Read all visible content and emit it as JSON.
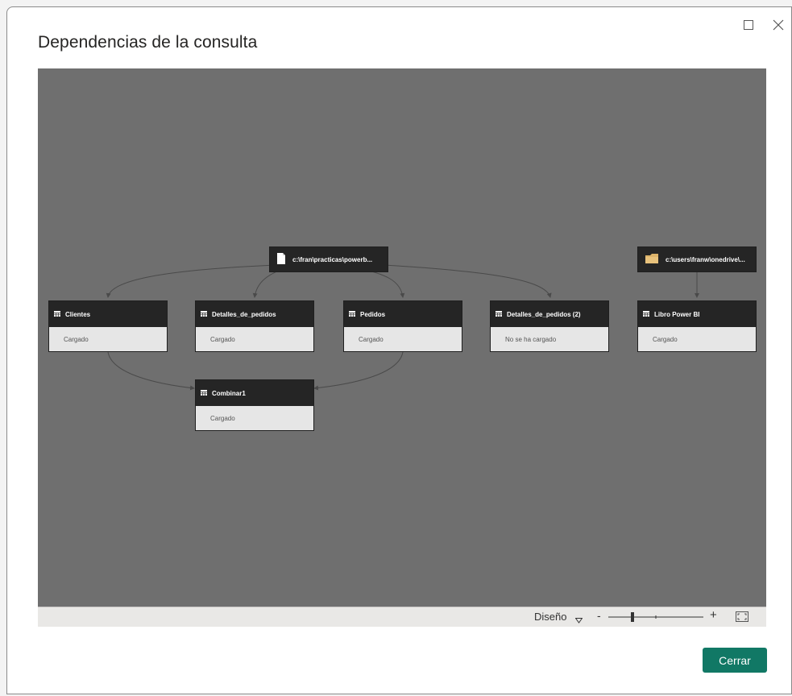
{
  "dialog": {
    "title": "Dependencias de la consulta",
    "close_label": "Cerrar"
  },
  "sources": [
    {
      "name": "c:\\fran\\practicas\\powerb...",
      "icon": "file-icon"
    },
    {
      "name": "c:\\users\\franw\\onedrive\\...",
      "icon": "folder-icon"
    }
  ],
  "queries": [
    {
      "name": "Clientes",
      "status": "Cargado"
    },
    {
      "name": "Detalles_de_pedidos",
      "status": "Cargado"
    },
    {
      "name": "Pedidos",
      "status": "Cargado"
    },
    {
      "name": "Detalles_de_pedidos (2)",
      "status": "No se ha cargado"
    },
    {
      "name": "Libro Power BI",
      "status": "Cargado"
    },
    {
      "name": "Combinar1",
      "status": "Cargado"
    }
  ],
  "toolbar": {
    "layout_label": "Diseño",
    "zoom_minus": "-",
    "zoom_plus": "+",
    "zoom_level": 0.25
  },
  "colors": {
    "canvas": "#6f6f6f",
    "node_header": "#252525",
    "node_body": "#e6e6e6",
    "accent": "#117865",
    "edge": "#4a4a4a"
  }
}
